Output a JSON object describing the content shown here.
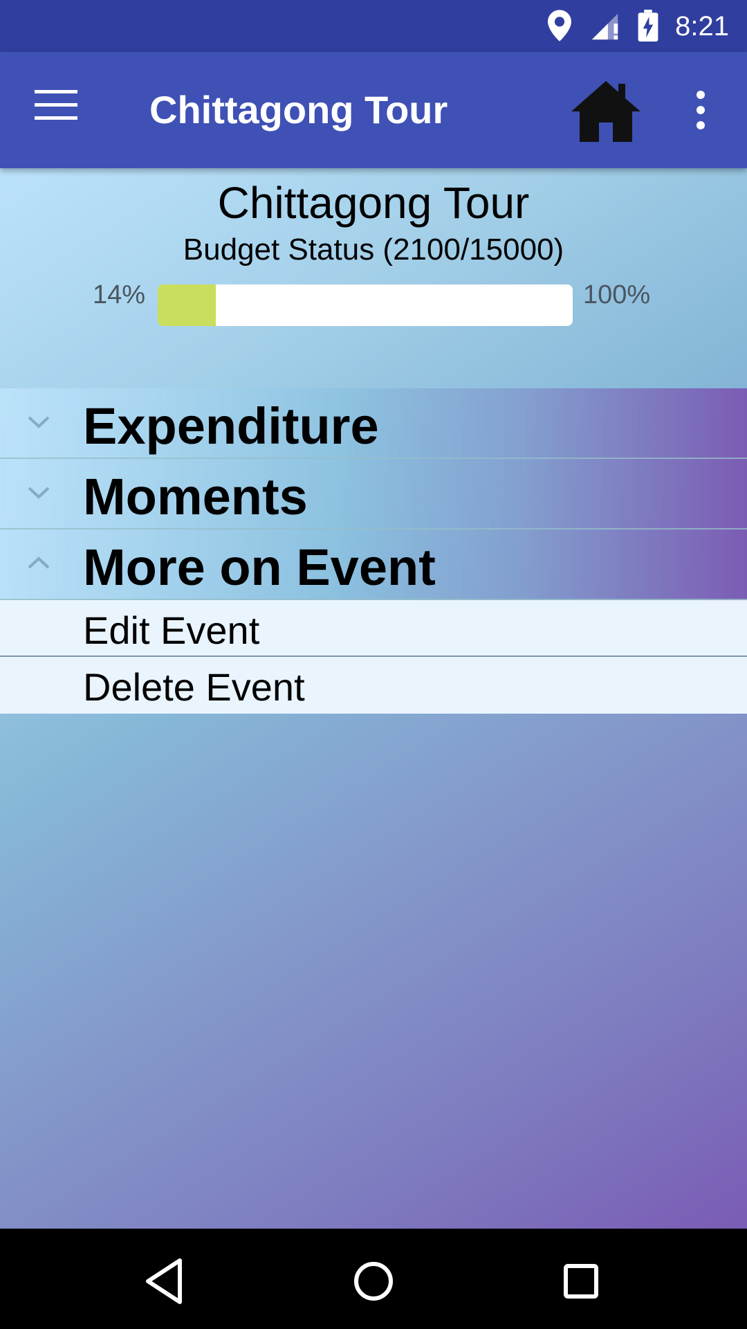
{
  "status_bar": {
    "time": "8:21",
    "icons": [
      "location-icon",
      "signal-icon",
      "battery-charging-icon"
    ]
  },
  "app_bar": {
    "title": "Chittagong Tour",
    "icons": [
      "menu-icon",
      "home-icon",
      "overflow-menu-icon"
    ],
    "color": "#3F51B5"
  },
  "header": {
    "title": "Chittagong Tour",
    "budget_status": "Budget Status (2100/15000)",
    "min_label": "14%",
    "max_label": "100%",
    "progress_fraction": 0.14,
    "progress_color": "#C9DE5C"
  },
  "groups": [
    {
      "label": "Expenditure",
      "expanded": false,
      "chevron": "chevron-down-icon"
    },
    {
      "label": "Moments",
      "expanded": false,
      "chevron": "chevron-down-icon"
    },
    {
      "label": "More on Event",
      "expanded": true,
      "chevron": "chevron-up-icon",
      "children": [
        {
          "label": "Edit Event"
        },
        {
          "label": "Delete Event"
        }
      ]
    }
  ],
  "nav_bar": {
    "icons": [
      "back-icon",
      "home-circle-icon",
      "recents-icon"
    ]
  }
}
